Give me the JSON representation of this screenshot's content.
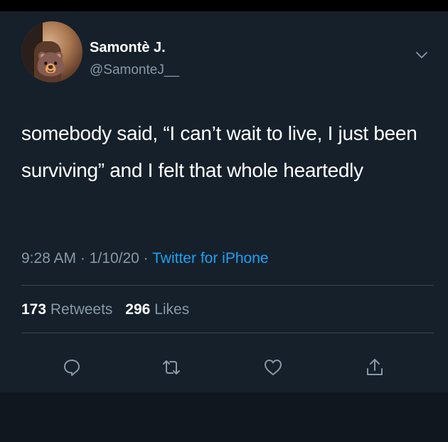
{
  "tweet": {
    "author": {
      "display_name": "Samontè J.",
      "handle": "@SamonteJ__",
      "avatar_emoji": "🐻"
    },
    "text": "somebody said, “I can’t wait to live, I just been surviving” and I felt that whole heartedly",
    "time": "9:28 AM",
    "date": "1/10/20",
    "separator": "·",
    "source": "Twitter for iPhone",
    "stats": {
      "retweets_count": "173",
      "retweets_label": "Retweets",
      "likes_count": "296",
      "likes_label": "Likes"
    }
  },
  "icons": {
    "menu": "chevron-down-icon",
    "reply": "reply-icon",
    "retweet": "retweet-icon",
    "like": "heart-icon",
    "share": "share-icon"
  },
  "colors": {
    "background": "#15202b",
    "text": "#ffffff",
    "secondary_text": "#8899a6",
    "accent": "#1da1f2",
    "divider": "#38444d"
  }
}
